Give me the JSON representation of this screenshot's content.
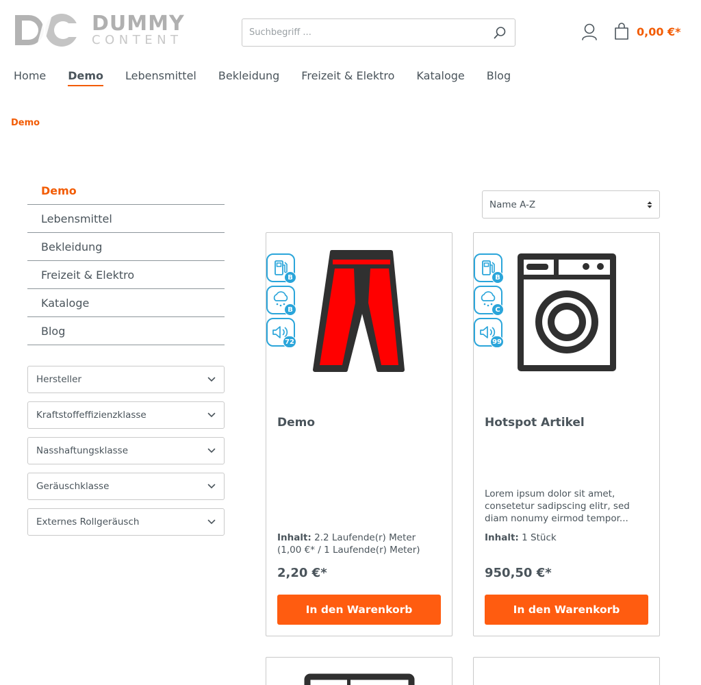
{
  "header": {
    "logo": {
      "initials": "DC",
      "brand_top": "DUMMY",
      "brand_bottom": "CONTENT"
    },
    "search": {
      "placeholder": "Suchbegriff ...",
      "value": "",
      "icon": "search-icon"
    },
    "account_icon": "user-icon",
    "cart": {
      "icon": "cart-icon",
      "price": "0,00 €*"
    }
  },
  "nav": {
    "items": [
      {
        "label": "Home"
      },
      {
        "label": "Demo"
      },
      {
        "label": "Lebensmittel"
      },
      {
        "label": "Bekleidung"
      },
      {
        "label": "Freizeit & Elektro"
      },
      {
        "label": "Kataloge"
      },
      {
        "label": "Blog"
      }
    ],
    "active": "Demo"
  },
  "breadcrumb": "Demo",
  "sidebar": {
    "categories": [
      {
        "label": "Demo"
      },
      {
        "label": "Lebensmittel"
      },
      {
        "label": "Bekleidung"
      },
      {
        "label": "Freizeit & Elektro"
      },
      {
        "label": "Kataloge"
      },
      {
        "label": "Blog"
      }
    ],
    "filters": [
      {
        "label": "Hersteller"
      },
      {
        "label": "Kraftstoffeffizienzklasse"
      },
      {
        "label": "Nasshaftungsklasse"
      },
      {
        "label": "Geräuschklasse"
      },
      {
        "label": "Externes Rollgeräusch"
      }
    ]
  },
  "sort": {
    "selected": "Name A-Z"
  },
  "products": [
    {
      "name": "Demo",
      "badges": [
        {
          "icon": "fuel-pump-icon",
          "value": "B"
        },
        {
          "icon": "rain-cloud-icon",
          "value": "B"
        },
        {
          "icon": "speaker-icon",
          "value": "72"
        }
      ],
      "description": "",
      "content_label": "Inhalt:",
      "content_value": "2.2 Laufende(r) Meter",
      "unit_price": "(1,00 €* / 1 Laufende(r) Meter)",
      "price": "2,20 €*",
      "button": "In den Warenkorb",
      "image": "pants-image",
      "colors": {
        "pants": "#ff0000",
        "outline": "#303030"
      }
    },
    {
      "name": "Hotspot Artikel",
      "badges": [
        {
          "icon": "fuel-pump-icon",
          "value": "B"
        },
        {
          "icon": "rain-cloud-icon",
          "value": "C"
        },
        {
          "icon": "speaker-icon",
          "value": "99"
        }
      ],
      "description": "Lorem ipsum dolor sit amet, consetetur sadipscing elitr, sed diam nonumy eirmod tempor...",
      "content_label": "Inhalt:",
      "content_value": "1 Stück",
      "unit_price": "",
      "price": "950,50 €*",
      "button": "In den Warenkorb",
      "image": "washing-machine-image"
    }
  ],
  "colors": {
    "accent": "#f25c05",
    "button": "#ff5c10",
    "badge": "#2aa5da",
    "text": "#4a545b"
  }
}
